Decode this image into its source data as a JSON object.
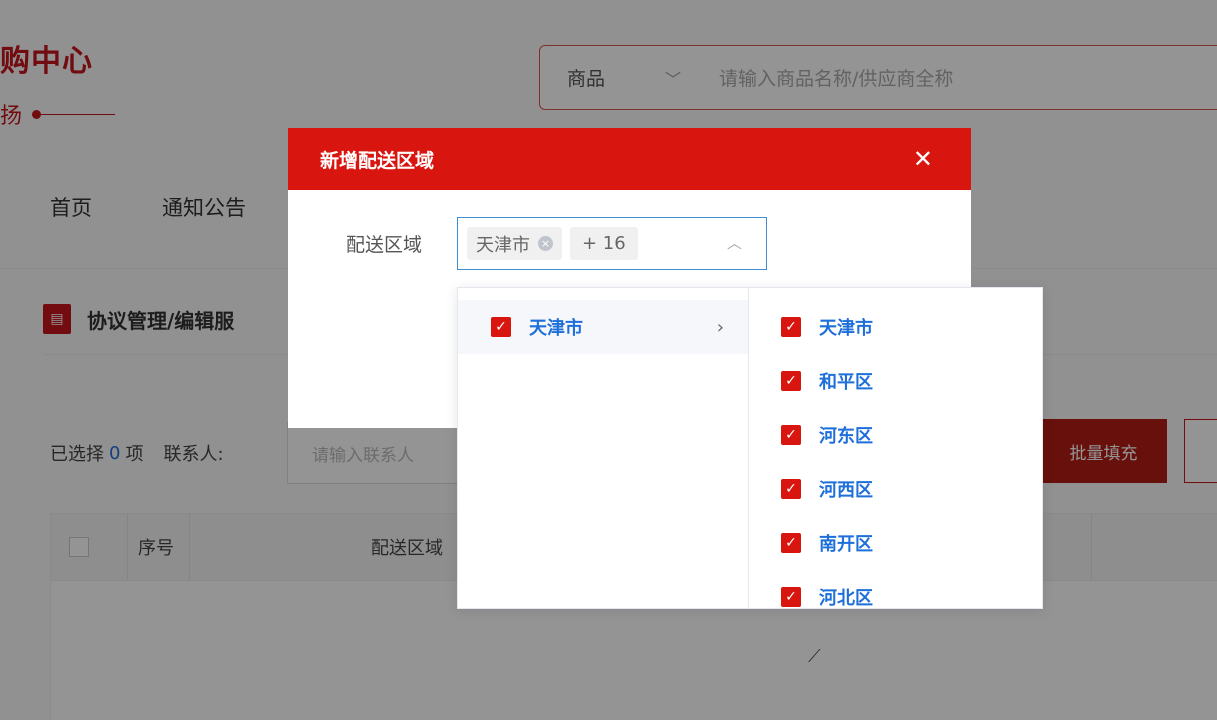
{
  "brand": {
    "title": "购中心",
    "subtitle": "扬"
  },
  "search": {
    "category": "商品",
    "placeholder": "请输入商品名称/供应商全称"
  },
  "nav": {
    "items": [
      "首页",
      "通知公告"
    ]
  },
  "section": {
    "title": "协议管理/编辑服"
  },
  "filter": {
    "selected_prefix": "已选择",
    "selected_count": "0",
    "selected_suffix": "项",
    "contact_label": "联系人:",
    "contact_placeholder": "请输入联系人",
    "batch_fill": "批量填充"
  },
  "table": {
    "columns": [
      "序号",
      "配送区域"
    ]
  },
  "dialog": {
    "title": "新增配送区域",
    "close_icon": "close-icon",
    "form_label": "配送区域",
    "tags": {
      "first": "天津市",
      "more": "+ 16"
    }
  },
  "dropdown": {
    "left": [
      {
        "label": "天津市",
        "checked": true,
        "has_children": true
      }
    ],
    "right": [
      {
        "label": "天津市",
        "checked": true
      },
      {
        "label": "和平区",
        "checked": true
      },
      {
        "label": "河东区",
        "checked": true
      },
      {
        "label": "河西区",
        "checked": true
      },
      {
        "label": "南开区",
        "checked": true
      },
      {
        "label": "河北区",
        "checked": true
      }
    ]
  },
  "colors": {
    "brand_red": "#c4161c",
    "dialog_red": "#d9150f",
    "link_blue": "#1e6fd9",
    "focus_blue": "#3e8ed0"
  }
}
